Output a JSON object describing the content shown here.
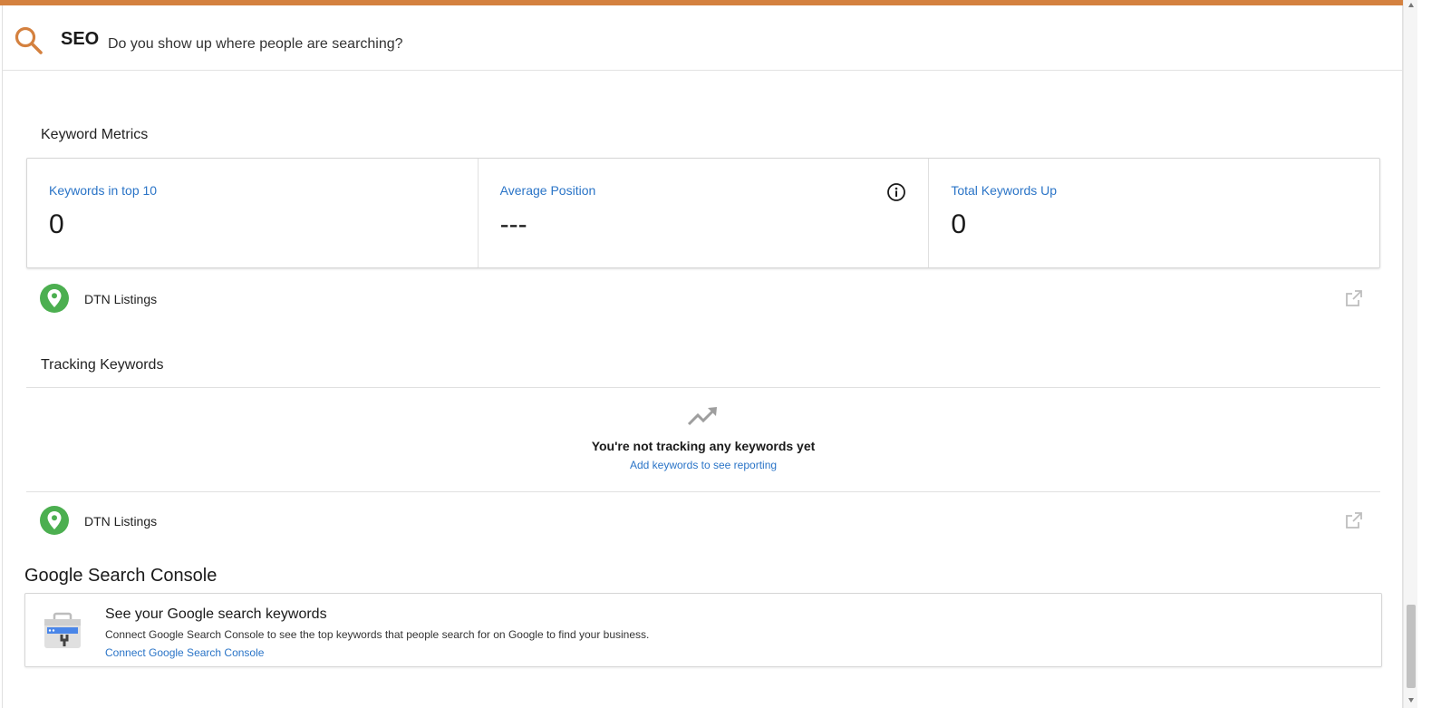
{
  "header": {
    "title": "SEO",
    "subtitle": "Do you show up where people are searching?"
  },
  "keyword_metrics": {
    "section_title": "Keyword Metrics",
    "metrics": [
      {
        "label": "Keywords in top 10",
        "value": "0"
      },
      {
        "label": "Average Position",
        "value": "---"
      },
      {
        "label": "Total Keywords Up",
        "value": "0"
      }
    ],
    "link_row": {
      "label": "DTN Listings"
    }
  },
  "tracking_keywords": {
    "section_title": "Tracking Keywords",
    "empty_title": "You're not tracking any keywords yet",
    "empty_link": "Add keywords to see reporting",
    "link_row": {
      "label": "DTN Listings"
    }
  },
  "google_search_console": {
    "heading": "Google Search Console",
    "card_title": "See your Google search keywords",
    "card_description": "Connect Google Search Console to see the top keywords that people search for on Google to find your business.",
    "card_link": "Connect Google Search Console"
  },
  "colors": {
    "accent": "#d4813f",
    "link": "#2a74c7",
    "pin": "#4caf50"
  },
  "icons": {
    "header": "search-icon",
    "info": "info-icon",
    "pin": "location-pin-icon",
    "open": "open-in-new-icon",
    "trend": "trending-up-icon",
    "gsc": "search-console-icon"
  }
}
